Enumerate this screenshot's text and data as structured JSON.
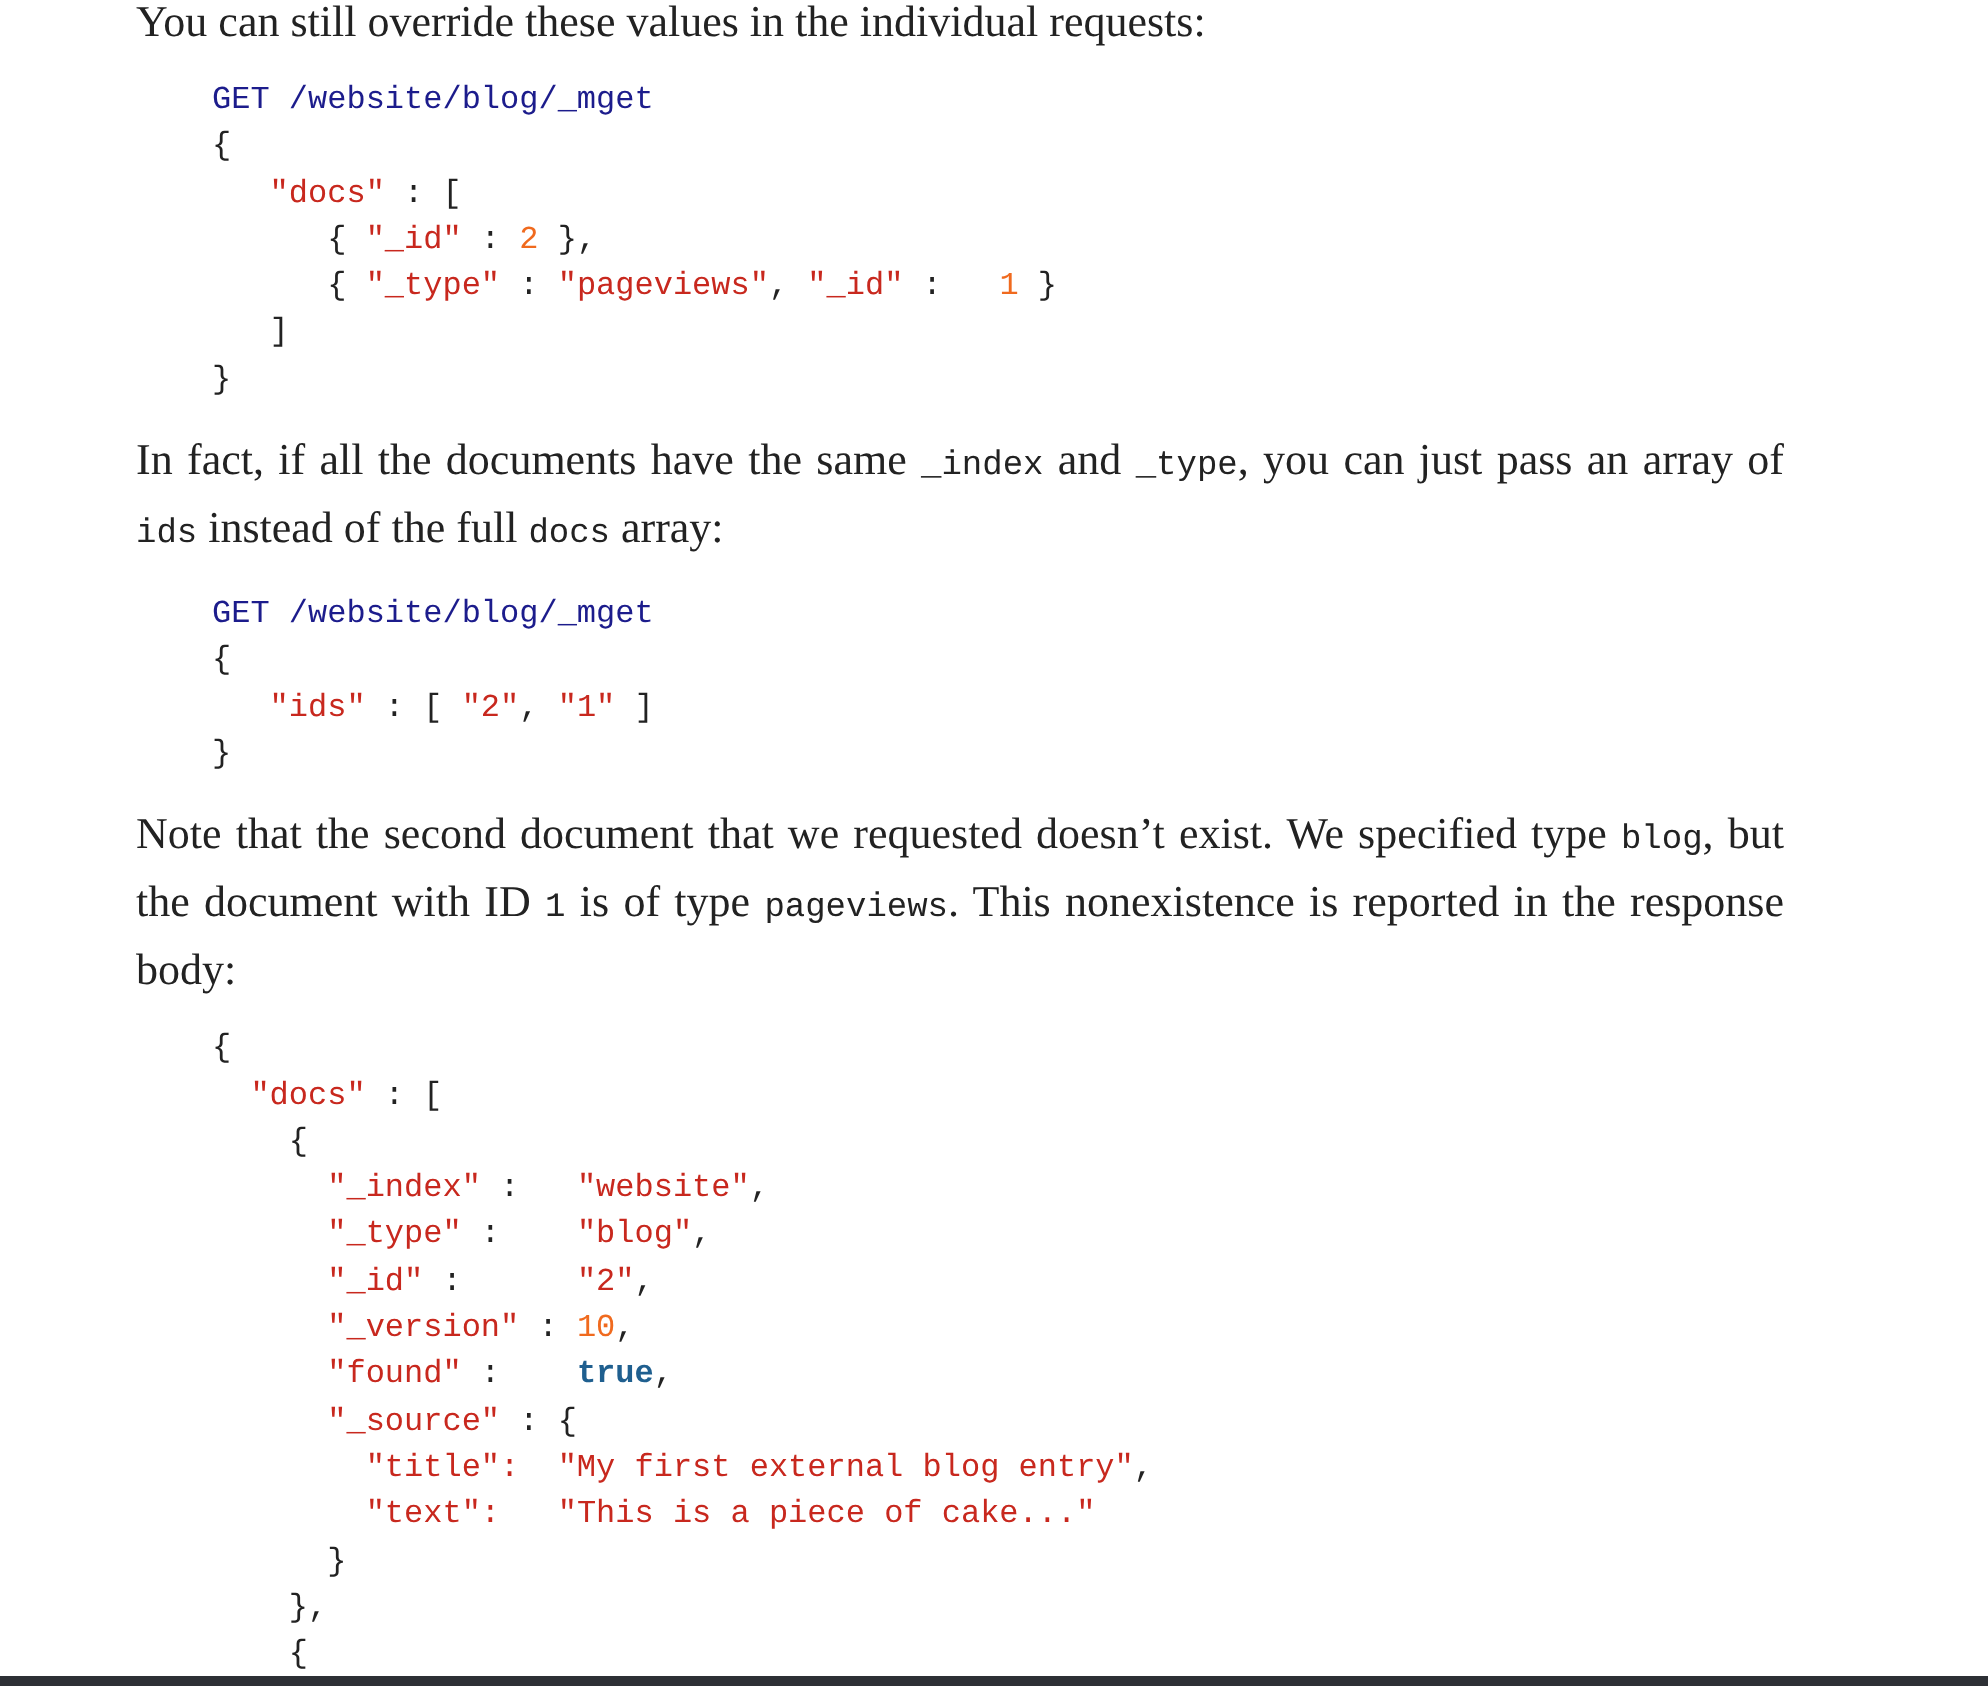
{
  "blocks": [
    {
      "kind": "paragraph",
      "segments": [
        {
          "text": "You can still override these values in the individual requests:",
          "kind": "prose"
        }
      ]
    },
    {
      "kind": "code",
      "lines": [
        [
          {
            "text": "GET /website/blog/_mget",
            "kind": "method"
          }
        ],
        [
          {
            "text": "{",
            "kind": "plain"
          }
        ],
        [
          {
            "text": "   \"docs\"",
            "kind": "string"
          },
          {
            "text": " : [",
            "kind": "plain"
          }
        ],
        [
          {
            "text": "      { ",
            "kind": "plain"
          },
          {
            "text": "\"_id\"",
            "kind": "string"
          },
          {
            "text": " : ",
            "kind": "plain"
          },
          {
            "text": "2",
            "kind": "number"
          },
          {
            "text": " },",
            "kind": "plain"
          }
        ],
        [
          {
            "text": "      { ",
            "kind": "plain"
          },
          {
            "text": "\"_type\"",
            "kind": "string"
          },
          {
            "text": " : ",
            "kind": "plain"
          },
          {
            "text": "\"pageviews\"",
            "kind": "string"
          },
          {
            "text": ", ",
            "kind": "plain"
          },
          {
            "text": "\"_id\"",
            "kind": "string"
          },
          {
            "text": " :   ",
            "kind": "plain"
          },
          {
            "text": "1",
            "kind": "number"
          },
          {
            "text": " }",
            "kind": "plain"
          }
        ],
        [
          {
            "text": "   ]",
            "kind": "plain"
          }
        ],
        [
          {
            "text": "}",
            "kind": "plain"
          }
        ]
      ]
    },
    {
      "kind": "paragraph",
      "segments": [
        {
          "text": "In fact, if all the documents have the same ",
          "kind": "prose"
        },
        {
          "text": "_index",
          "kind": "code"
        },
        {
          "text": " and ",
          "kind": "prose"
        },
        {
          "text": "_type",
          "kind": "code"
        },
        {
          "text": ", you can just pass an array of ",
          "kind": "prose"
        },
        {
          "text": "ids",
          "kind": "code"
        },
        {
          "text": " instead of the full ",
          "kind": "prose"
        },
        {
          "text": "docs",
          "kind": "code"
        },
        {
          "text": " array:",
          "kind": "prose"
        }
      ]
    },
    {
      "kind": "code",
      "lines": [
        [
          {
            "text": "GET /website/blog/_mget",
            "kind": "method"
          }
        ],
        [
          {
            "text": "{",
            "kind": "plain"
          }
        ],
        [
          {
            "text": "   \"ids\"",
            "kind": "string"
          },
          {
            "text": " : [ ",
            "kind": "plain"
          },
          {
            "text": "\"2\"",
            "kind": "string"
          },
          {
            "text": ", ",
            "kind": "plain"
          },
          {
            "text": "\"1\"",
            "kind": "string"
          },
          {
            "text": " ]",
            "kind": "plain"
          }
        ],
        [
          {
            "text": "}",
            "kind": "plain"
          }
        ]
      ]
    },
    {
      "kind": "paragraph",
      "segments": [
        {
          "text": "Note that the second document that we requested doesn’t exist. We specified type ",
          "kind": "prose"
        },
        {
          "text": "blog",
          "kind": "code"
        },
        {
          "text": ", but the document with ID ",
          "kind": "prose"
        },
        {
          "text": "1",
          "kind": "code"
        },
        {
          "text": " is of type ",
          "kind": "prose"
        },
        {
          "text": "pageviews",
          "kind": "code"
        },
        {
          "text": ". This nonexistence is reported in the response body:",
          "kind": "prose"
        }
      ]
    },
    {
      "kind": "code",
      "lines": [
        [
          {
            "text": "{",
            "kind": "plain"
          }
        ],
        [
          {
            "text": "  \"docs\"",
            "kind": "string"
          },
          {
            "text": " : [",
            "kind": "plain"
          }
        ],
        [
          {
            "text": "    {",
            "kind": "plain"
          }
        ],
        [
          {
            "text": "      \"_index\"",
            "kind": "string"
          },
          {
            "text": " :   ",
            "kind": "plain"
          },
          {
            "text": "\"website\"",
            "kind": "string"
          },
          {
            "text": ",",
            "kind": "plain"
          }
        ],
        [
          {
            "text": "      \"_type\"",
            "kind": "string"
          },
          {
            "text": " :    ",
            "kind": "plain"
          },
          {
            "text": "\"blog\"",
            "kind": "string"
          },
          {
            "text": ",",
            "kind": "plain"
          }
        ],
        [
          {
            "text": "      \"_id\"",
            "kind": "string"
          },
          {
            "text": " :      ",
            "kind": "plain"
          },
          {
            "text": "\"2\"",
            "kind": "string"
          },
          {
            "text": ",",
            "kind": "plain"
          }
        ],
        [
          {
            "text": "      \"_version\"",
            "kind": "string"
          },
          {
            "text": " : ",
            "kind": "plain"
          },
          {
            "text": "10",
            "kind": "number"
          },
          {
            "text": ",",
            "kind": "plain"
          }
        ],
        [
          {
            "text": "      \"found\"",
            "kind": "string"
          },
          {
            "text": " :    ",
            "kind": "plain"
          },
          {
            "text": "true",
            "kind": "literal"
          },
          {
            "text": ",",
            "kind": "plain"
          }
        ],
        [
          {
            "text": "      \"_source\"",
            "kind": "string"
          },
          {
            "text": " : {",
            "kind": "plain"
          }
        ],
        [
          {
            "text": "        \"title\":",
            "kind": "string"
          },
          {
            "text": "  \"My first external blog entry\"",
            "kind": "string"
          },
          {
            "text": ",",
            "kind": "plain"
          }
        ],
        [
          {
            "text": "        \"text\":",
            "kind": "string"
          },
          {
            "text": "   \"This is a piece of cake...\"",
            "kind": "string"
          }
        ],
        [
          {
            "text": "      }",
            "kind": "plain"
          }
        ],
        [
          {
            "text": "    },",
            "kind": "plain"
          }
        ],
        [
          {
            "text": "    {",
            "kind": "plain"
          }
        ]
      ]
    }
  ]
}
